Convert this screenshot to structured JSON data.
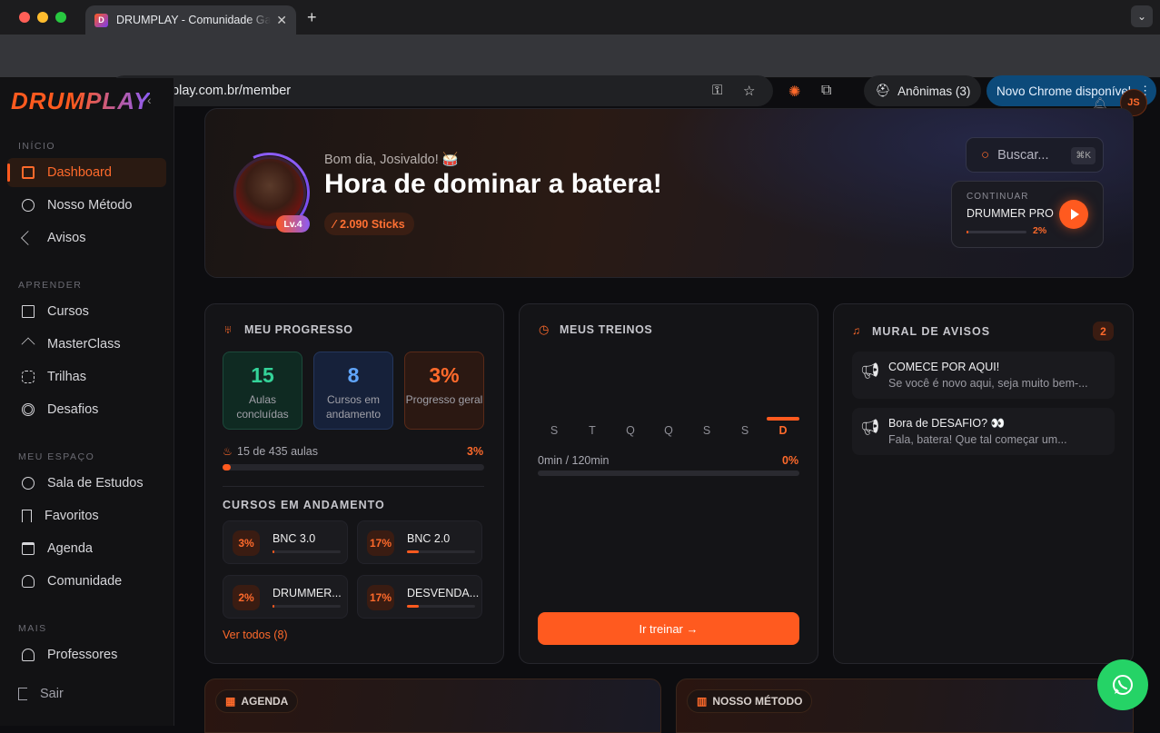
{
  "browser": {
    "tab_title": "DRUMPLAY - Comunidade Ga",
    "url": "drumplay.com.br/member",
    "incognito": "Anônimas (3)",
    "update": "Novo Chrome disponível",
    "favicon": "D"
  },
  "sidebar": {
    "logo": "DRUMPLAY",
    "sections": [
      "INÍCIO",
      "APRENDER",
      "MEU ESPAÇO",
      "MAIS"
    ],
    "items": [
      "Dashboard",
      "Nosso Método",
      "Avisos",
      "Cursos",
      "MasterClass",
      "Trilhas",
      "Desafios",
      "Sala de Estudos",
      "Favoritos",
      "Agenda",
      "Comunidade",
      "Professores"
    ],
    "logout": "Sair"
  },
  "header": {
    "avatar": "JS"
  },
  "hero": {
    "greeting": "Bom dia, Josivaldo! 🥁",
    "headline": "Hora de dominar a batera!",
    "level": "Lv.4",
    "sticks": "2.090 Sticks",
    "search_placeholder": "Buscar...",
    "search_kbd": "⌘K",
    "continue_label": "CONTINUAR",
    "continue_course": "DRUMMER PRO",
    "continue_pct": "2%",
    "continue_progress": 0.02
  },
  "progress": {
    "title": "MEU PROGRESSO",
    "stats": [
      {
        "value": "15",
        "label": "Aulas concluídas",
        "color": "#34d399"
      },
      {
        "value": "8",
        "label": "Cursos em andamento",
        "color": "#60a5fa"
      },
      {
        "value": "3%",
        "label": "Progresso geral",
        "color": "#ff6a2b"
      }
    ],
    "lessons": "15 de 435 aulas",
    "lessons_pct": "3%",
    "courses_title": "CURSOS EM ANDAMENTO",
    "courses": [
      {
        "pct": "3%",
        "name": "BNC 3.0",
        "progress": 0.03
      },
      {
        "pct": "17%",
        "name": "BNC 2.0",
        "progress": 0.17
      },
      {
        "pct": "2%",
        "name": "DRUMMER...",
        "progress": 0.02
      },
      {
        "pct": "17%",
        "name": "DESVENDA...",
        "progress": 0.17
      }
    ],
    "see_all": "Ver todos (8)"
  },
  "training": {
    "title": "MEUS TREINOS",
    "days": [
      "S",
      "T",
      "Q",
      "Q",
      "S",
      "S",
      "D"
    ],
    "time": "0min / 120min",
    "pct": "0%",
    "button": "Ir treinar →"
  },
  "notices": {
    "title": "MURAL DE AVISOS",
    "count": "2",
    "items": [
      {
        "title": "COMECE POR AQUI!",
        "text": "Se você é novo aqui, seja muito bem-..."
      },
      {
        "title": "Bora de DESAFIO? 👀",
        "text": "Fala, batera! Que tal começar um..."
      }
    ]
  },
  "bottom": {
    "agenda": "AGENDA",
    "method": "NOSSO MÉTODO"
  }
}
